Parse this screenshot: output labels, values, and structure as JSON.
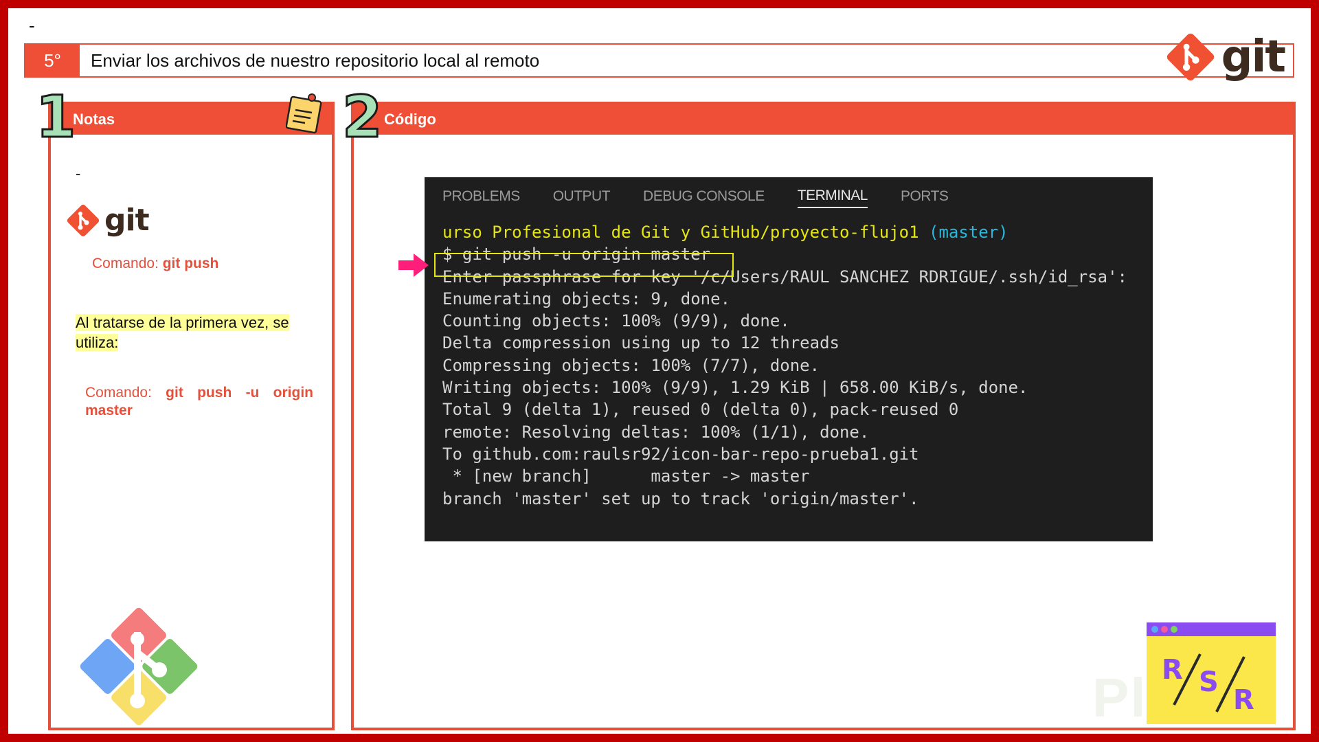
{
  "page": {
    "top_marker": "-"
  },
  "header": {
    "step_number": "5°",
    "title": "Enviar los archivos de nuestro repositorio local al remoto",
    "logo_text": "git"
  },
  "notes_panel": {
    "number": "1",
    "title": "Notas",
    "dash": "-",
    "logo_text": "git",
    "command1_label": "Comando:",
    "command1_value": "git push",
    "highlight_text": "Al tratarse de la primera vez, se utiliza:",
    "command2_label": "Comando:",
    "command2_words": [
      "git",
      "push",
      "-u",
      "origin"
    ],
    "command2_last": "master"
  },
  "code_panel": {
    "number": "2",
    "title": "Código"
  },
  "terminal": {
    "tabs": [
      {
        "label": "PROBLEMS",
        "active": false
      },
      {
        "label": "OUTPUT",
        "active": false
      },
      {
        "label": "DEBUG CONSOLE",
        "active": false
      },
      {
        "label": "TERMINAL",
        "active": true
      },
      {
        "label": "PORTS",
        "active": false
      }
    ],
    "prompt_path": "urso Profesional de Git y GitHub/proyecto-flujo1",
    "prompt_branch": "(master)",
    "command": "$ git push -u origin master",
    "output": [
      "Enter passphrase for key '/c/Users/RAUL SANCHEZ RDRIGUE/.ssh/id_rsa':",
      "Enumerating objects: 9, done.",
      "Counting objects: 100% (9/9), done.",
      "Delta compression using up to 12 threads",
      "Compressing objects: 100% (7/7), done.",
      "Writing objects: 100% (9/9), 1.29 KiB | 658.00 KiB/s, done.",
      "Total 9 (delta 1), reused 0 (delta 0), pack-reused 0",
      "remote: Resolving deltas: 100% (1/1), done.",
      "To github.com:raulsr92/icon-bar-repo-prueba1.git",
      " * [new branch]      master -> master",
      "branch 'master' set up to track 'origin/master'."
    ]
  },
  "branding": {
    "rsr_letters": [
      "R",
      "S",
      "R"
    ],
    "watermark": "Platzi"
  },
  "colors": {
    "accent": "#ef4f36",
    "frame": "#c00000",
    "git_orange": "#f05133",
    "terminal_bg": "#1e1e1e",
    "prompt_yellow": "#e5e510",
    "branch_blue": "#29b8db",
    "highlight": "#ffff99",
    "arrow_pink": "#ff1f7a"
  }
}
